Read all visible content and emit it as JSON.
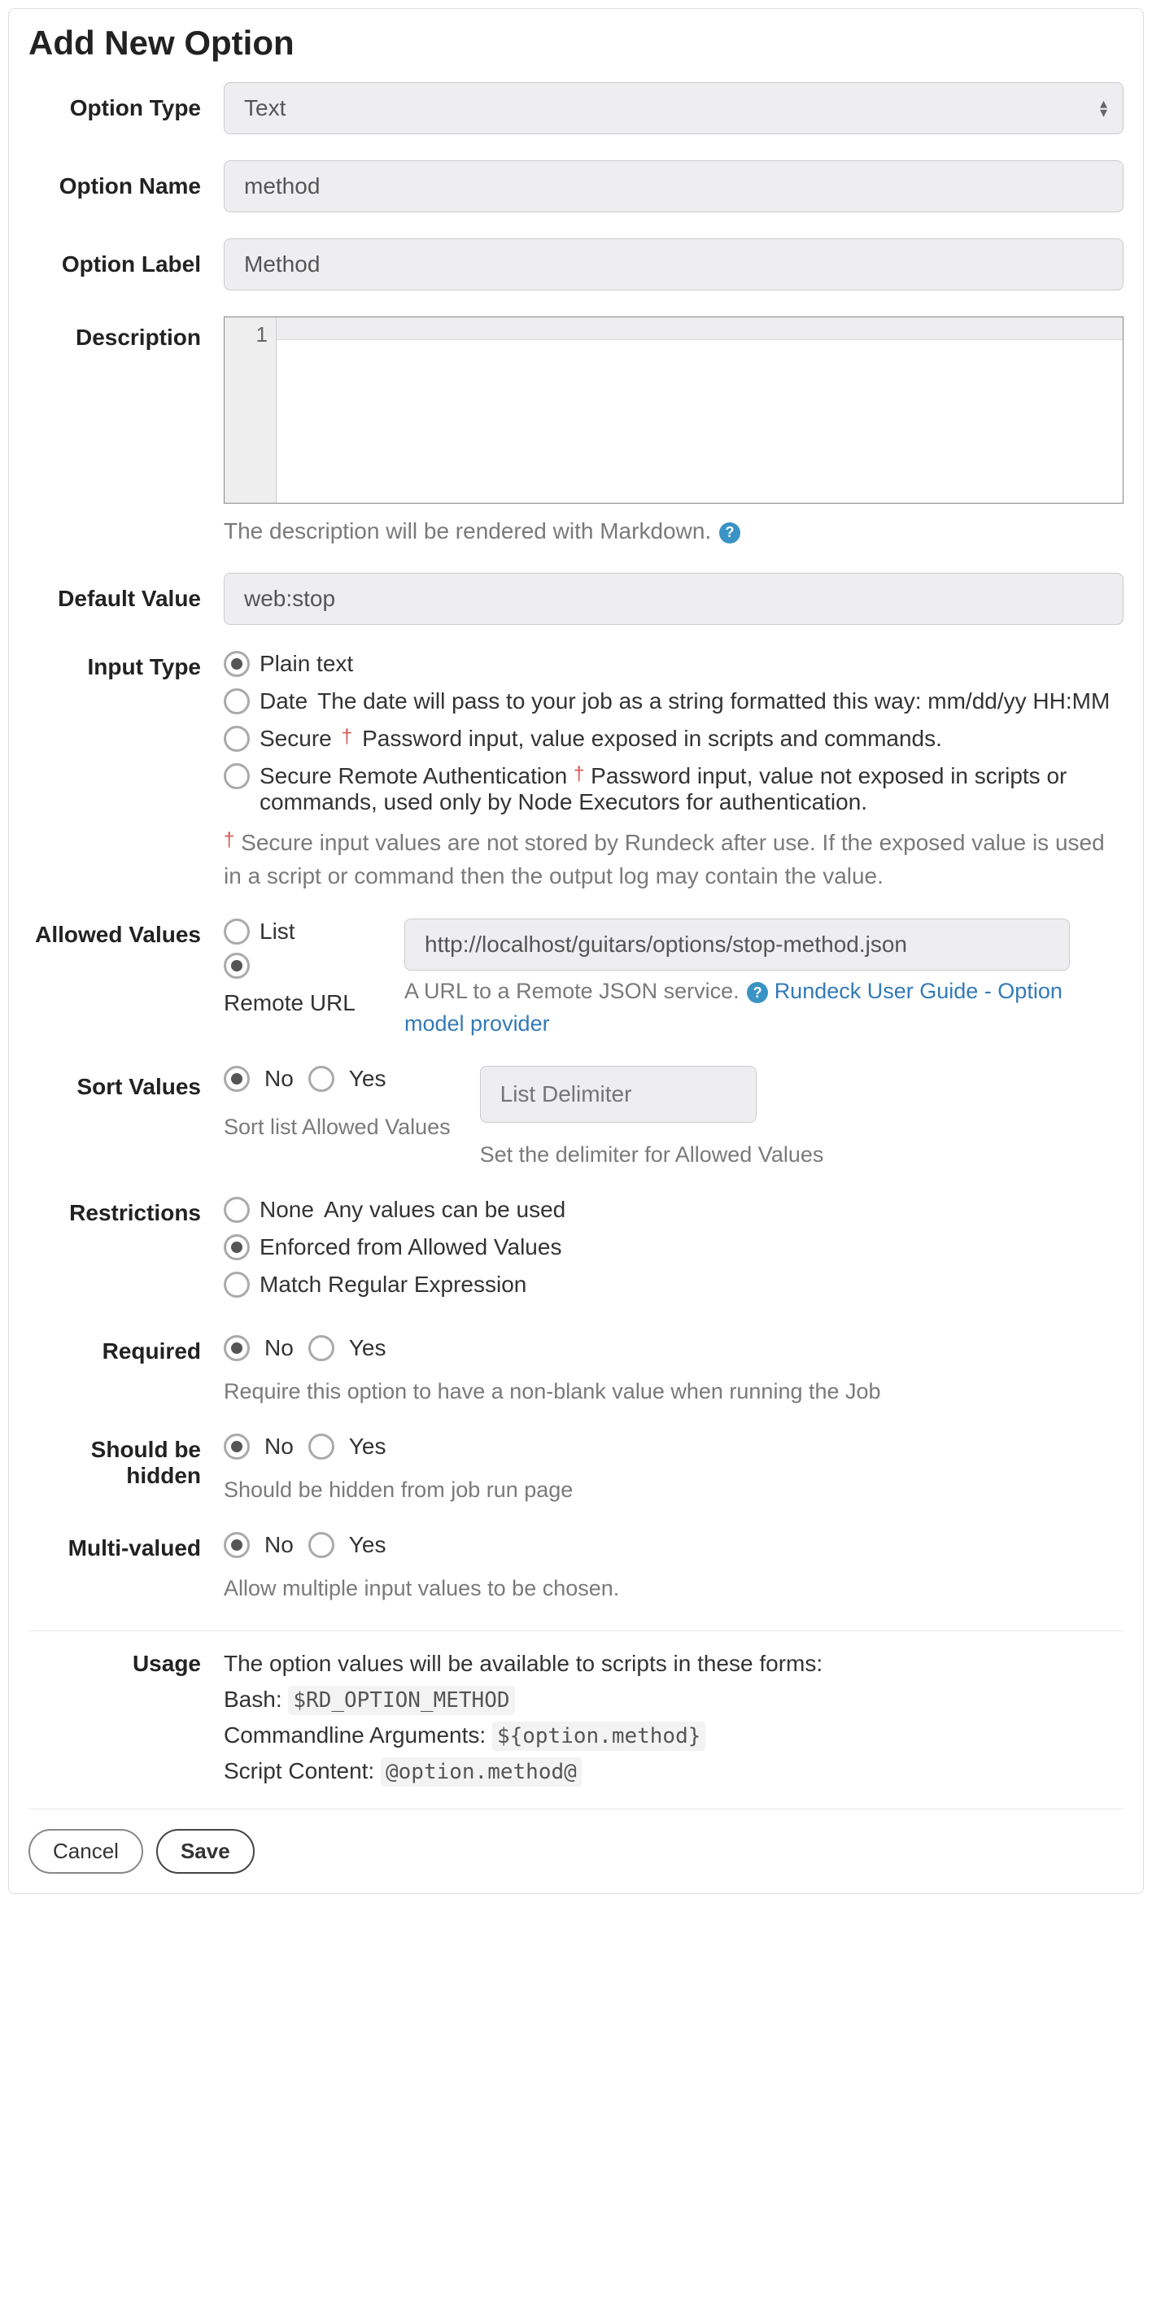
{
  "title": "Add New Option",
  "labels": {
    "optionType": "Option Type",
    "optionName": "Option Name",
    "optionLabel": "Option Label",
    "description": "Description",
    "defaultValue": "Default Value",
    "inputType": "Input Type",
    "allowedValues": "Allowed Values",
    "sortValues": "Sort Values",
    "restrictions": "Restrictions",
    "required": "Required",
    "shouldBeHidden": "Should be hidden",
    "multiValued": "Multi-valued",
    "usage": "Usage"
  },
  "fields": {
    "optionType": "Text",
    "optionName": "method",
    "optionLabel": "Method",
    "descriptionLine": "1",
    "descriptionHelp": "The description will be rendered with Markdown.",
    "defaultValue": "web:stop",
    "remoteUrl": "http://localhost/guitars/options/stop-method.json",
    "listDelimiterPlaceholder": "List Delimiter"
  },
  "inputType": {
    "options": {
      "plain": "Plain text",
      "date": "Date",
      "dateDesc": "The date will pass to your job as a string formatted this way: mm/dd/yy HH:MM",
      "secure": "Secure",
      "secureDesc": "Password input, value exposed in scripts and commands.",
      "secureRemote": "Secure Remote Authentication",
      "secureRemoteDesc": "Password input, value not exposed in scripts or commands, used only by Node Executors for authentication."
    },
    "note": "Secure input values are not stored by Rundeck after use. If the exposed value is used in a script or command then the output log may contain the value."
  },
  "allowedValues": {
    "list": "List",
    "remote": "Remote URL",
    "remoteHelp": "A URL to a Remote JSON service.",
    "remoteLink": "Rundeck User Guide - Option model provider"
  },
  "sortValues": {
    "no": "No",
    "yes": "Yes",
    "help": "Sort list Allowed Values",
    "delimiterHelp": "Set the delimiter for Allowed Values"
  },
  "restrictions": {
    "none": "None",
    "noneDesc": "Any values can be used",
    "enforced": "Enforced from Allowed Values",
    "regex": "Match Regular Expression"
  },
  "required": {
    "no": "No",
    "yes": "Yes",
    "help": "Require this option to have a non-blank value when running the Job"
  },
  "hidden": {
    "no": "No",
    "yes": "Yes",
    "help": "Should be hidden from job run page"
  },
  "multiValued": {
    "no": "No",
    "yes": "Yes",
    "help": "Allow multiple input values to be chosen."
  },
  "usage": {
    "intro": "The option values will be available to scripts in these forms:",
    "bashLabel": "Bash:",
    "bashCode": "$RD_OPTION_METHOD",
    "cmdLabel": "Commandline Arguments:",
    "cmdCode": "${option.method}",
    "scriptLabel": "Script Content:",
    "scriptCode": "@option.method@"
  },
  "buttons": {
    "cancel": "Cancel",
    "save": "Save"
  },
  "glyphs": {
    "dagger": "†",
    "question": "?"
  }
}
